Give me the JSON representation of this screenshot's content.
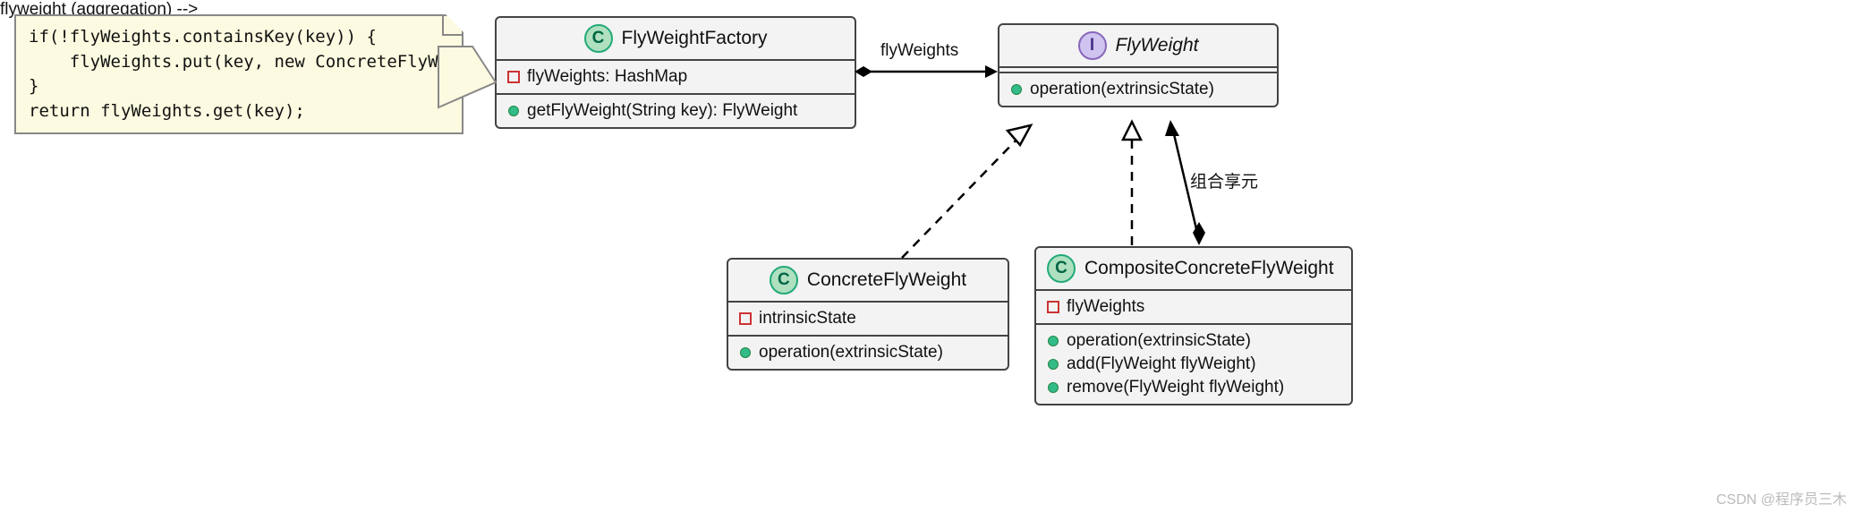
{
  "note": {
    "code": "if(!flyWeights.containsKey(key)) {\n    flyWeights.put(key, new ConcreteFlyWeight);\n}\nreturn flyWeights.get(key);"
  },
  "classes": {
    "factory": {
      "stereotype": "C",
      "name": "FlyWeightFactory",
      "attrs": [
        {
          "vis": "priv",
          "text": "flyWeights: HashMap"
        }
      ],
      "ops": [
        {
          "vis": "pub",
          "text": "getFlyWeight(String key): FlyWeight"
        }
      ]
    },
    "flyweight": {
      "stereotype": "I",
      "name": "FlyWeight",
      "italic": true,
      "ops": [
        {
          "vis": "pub",
          "text": "operation(extrinsicState)"
        }
      ]
    },
    "concrete": {
      "stereotype": "C",
      "name": "ConcreteFlyWeight",
      "attrs": [
        {
          "vis": "priv",
          "text": "intrinsicState"
        }
      ],
      "ops": [
        {
          "vis": "pub",
          "text": "operation(extrinsicState)"
        }
      ]
    },
    "composite": {
      "stereotype": "C",
      "name": "CompositeConcreteFlyWeight",
      "attrs": [
        {
          "vis": "priv",
          "text": "flyWeights"
        }
      ],
      "ops": [
        {
          "vis": "pub",
          "text": "operation(extrinsicState)"
        },
        {
          "vis": "pub",
          "text": "add(FlyWeight flyWeight)"
        },
        {
          "vis": "pub",
          "text": "remove(FlyWeight flyWeight)"
        }
      ]
    }
  },
  "labels": {
    "assoc": "flyWeights",
    "compRel": "组合享元"
  },
  "watermark": "CSDN @程序员三木"
}
